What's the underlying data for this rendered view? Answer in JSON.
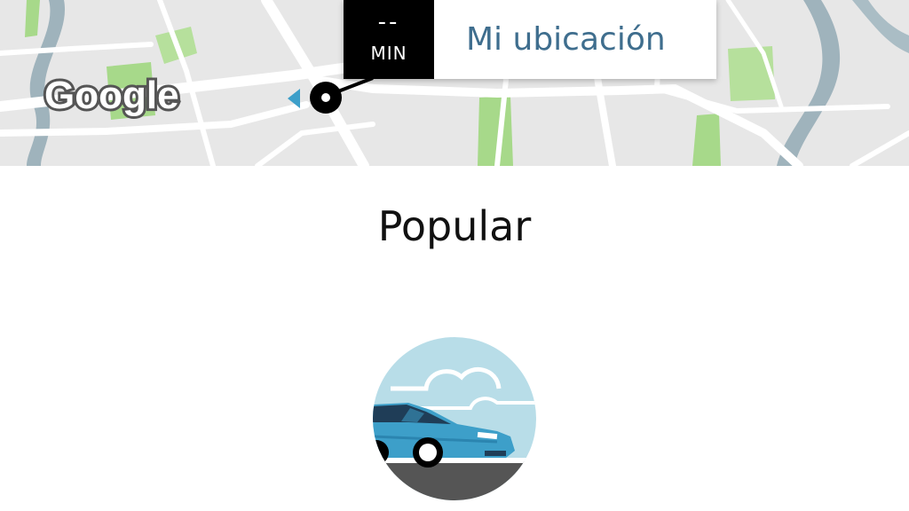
{
  "map": {
    "provider_logo": "Google",
    "pickup_marker": {
      "eta_value": "--",
      "eta_unit": "MIN",
      "location_label": "Mi ubicación"
    },
    "icons": [
      "location-pin-icon",
      "direction-arrow-icon"
    ]
  },
  "product_section": {
    "title": "Popular",
    "vehicle_icon": "car-icon"
  },
  "colors": {
    "map_background": "#e8e8e8",
    "road": "#ffffff",
    "river": "#9fb3bc",
    "park": "#a7d98a",
    "location_text": "#3f6e8e",
    "eta_background": "#000000",
    "car_body": "#3d9fc9",
    "car_sky": "#b8dde8"
  }
}
